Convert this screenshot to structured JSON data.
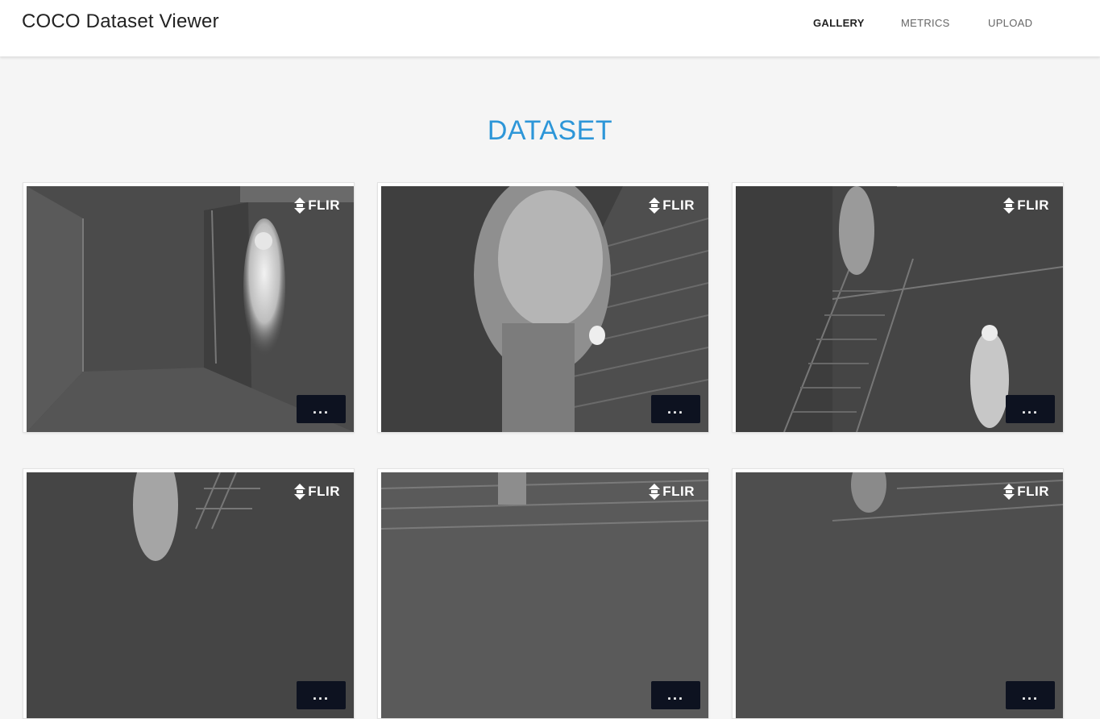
{
  "header": {
    "title": "COCO Dataset Viewer",
    "nav": [
      {
        "label": "GALLERY",
        "active": true
      },
      {
        "label": "METRICS",
        "active": false
      },
      {
        "label": "UPLOAD",
        "active": false
      }
    ]
  },
  "main": {
    "heading": "DATASET",
    "accent_color": "#2d96d8",
    "cards": [
      {
        "watermark": "FLIR",
        "more_label": "...",
        "scene": "hallway-person"
      },
      {
        "watermark": "FLIR",
        "more_label": "...",
        "scene": "stairs-closeup-person"
      },
      {
        "watermark": "FLIR",
        "more_label": "...",
        "scene": "stairwell-two-people"
      },
      {
        "watermark": "FLIR",
        "more_label": "...",
        "scene": "stairwell-person"
      },
      {
        "watermark": "FLIR",
        "more_label": "...",
        "scene": "stairs-legs"
      },
      {
        "watermark": "FLIR",
        "more_label": "...",
        "scene": "stairwell-person"
      }
    ]
  }
}
